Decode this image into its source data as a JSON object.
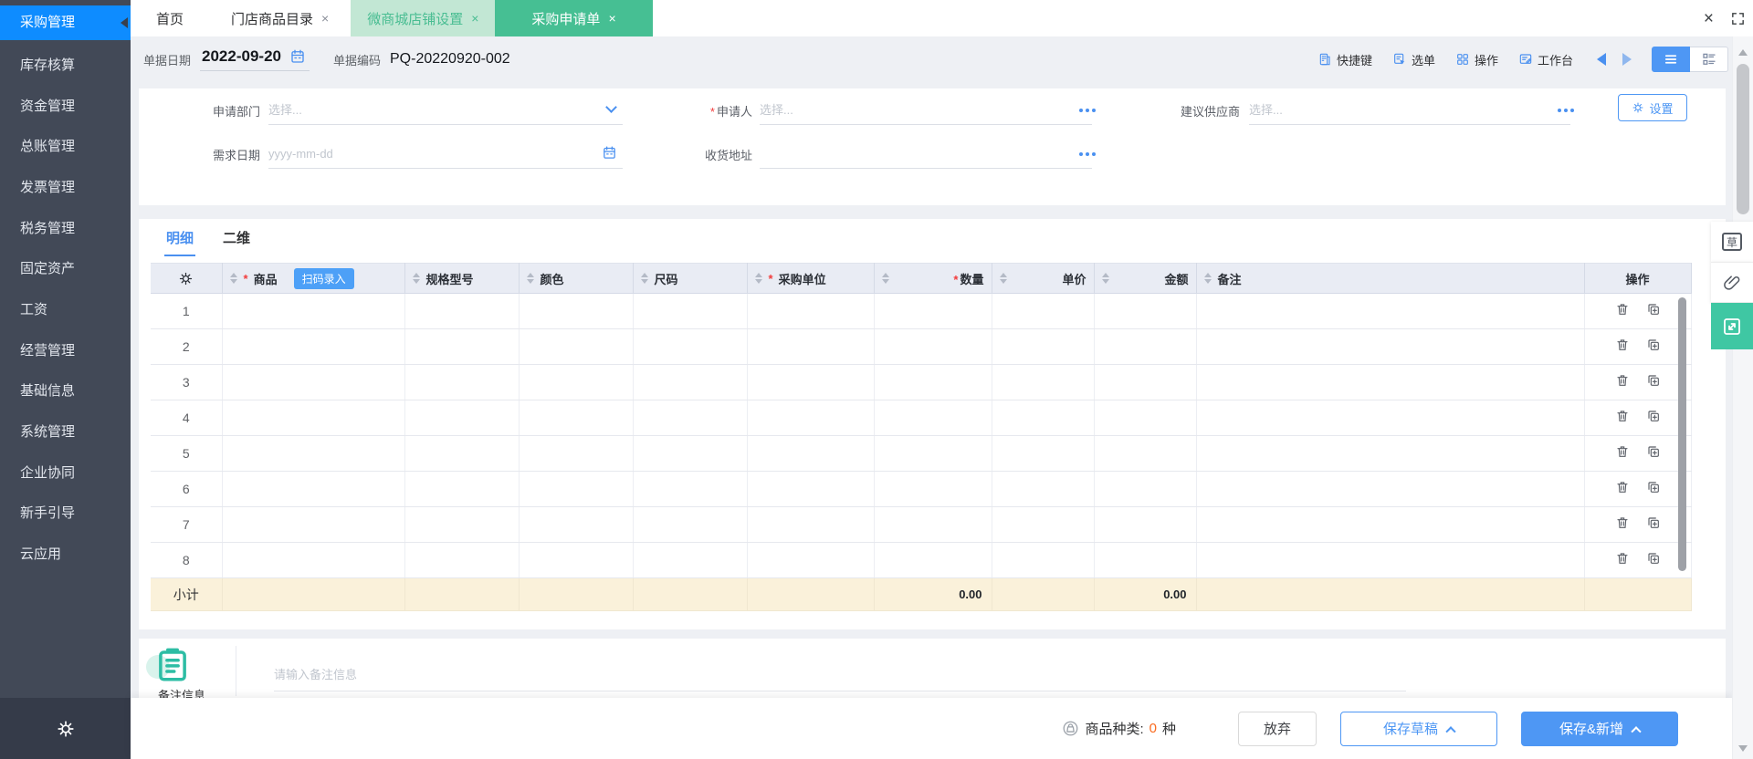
{
  "ui": {
    "close_glyph": "×",
    "required_mark": "*"
  },
  "sidebar": {
    "items": [
      {
        "label": "采购管理",
        "active": true
      },
      {
        "label": "库存核算"
      },
      {
        "label": "资金管理"
      },
      {
        "label": "总账管理"
      },
      {
        "label": "发票管理"
      },
      {
        "label": "税务管理"
      },
      {
        "label": "固定资产"
      },
      {
        "label": "工资"
      },
      {
        "label": "经营管理"
      },
      {
        "label": "基础信息"
      },
      {
        "label": "系统管理"
      },
      {
        "label": "企业协同"
      },
      {
        "label": "新手引导"
      },
      {
        "label": "云应用"
      }
    ]
  },
  "tabs": {
    "items": [
      {
        "label": "首页"
      },
      {
        "label": "门店商品目录",
        "closable": true
      },
      {
        "label": "微商城店铺设置",
        "closable": true
      },
      {
        "label": "采购申请单",
        "closable": true,
        "active": true
      }
    ]
  },
  "doc": {
    "date_label": "单据日期",
    "date_value": "2022-09-20",
    "code_label": "单据编码",
    "code_value": "PQ-20220920-002"
  },
  "toolbar": {
    "shortcut": "快捷键",
    "pick": "选单",
    "actions": "操作",
    "workbench": "工作台"
  },
  "form": {
    "dept_label": "申请部门",
    "dept_placeholder": "选择...",
    "applicant_label": "申请人",
    "applicant_placeholder": "选择...",
    "supplier_label": "建议供应商",
    "supplier_placeholder": "选择...",
    "need_date_label": "需求日期",
    "need_date_placeholder": "yyyy-mm-dd",
    "address_label": "收货地址",
    "settings_button": "设置"
  },
  "detail_tabs": {
    "detail": "明细",
    "matrix": "二维"
  },
  "table": {
    "scan_button": "扫码录入",
    "columns": [
      {
        "label": "商品",
        "required": true
      },
      {
        "label": "规格型号"
      },
      {
        "label": "颜色"
      },
      {
        "label": "尺码"
      },
      {
        "label": "采购单位",
        "required": true
      },
      {
        "label": "数量",
        "required": true
      },
      {
        "label": "单价"
      },
      {
        "label": "金额"
      },
      {
        "label": "备注"
      },
      {
        "label": "操作"
      }
    ],
    "rows": [
      "1",
      "2",
      "3",
      "4",
      "5",
      "6",
      "7",
      "8"
    ],
    "subtotal": {
      "label": "小计",
      "qty": "0.00",
      "amount": "0.00"
    }
  },
  "remark": {
    "label": "备注信息",
    "placeholder": "请输入备注信息"
  },
  "footer": {
    "species_label": "商品种类:",
    "species_count": "0",
    "species_unit": "种",
    "cancel": "放弃",
    "save_draft": "保存草稿",
    "save_new": "保存&新增"
  },
  "floating": {
    "draft_char": "草"
  },
  "colors": {
    "sidebar_bg": "#424957",
    "sidebar_active": "#0e8cff",
    "accent_blue": "#4e97f4",
    "tab_green": "#46bf93",
    "tab_green_light": "#c2e7d4",
    "table_header_bg": "#e9ecf4",
    "subtotal_bg": "#faf1da",
    "count_orange": "#fa6a1e",
    "remark_teal": "#2dbda4"
  }
}
